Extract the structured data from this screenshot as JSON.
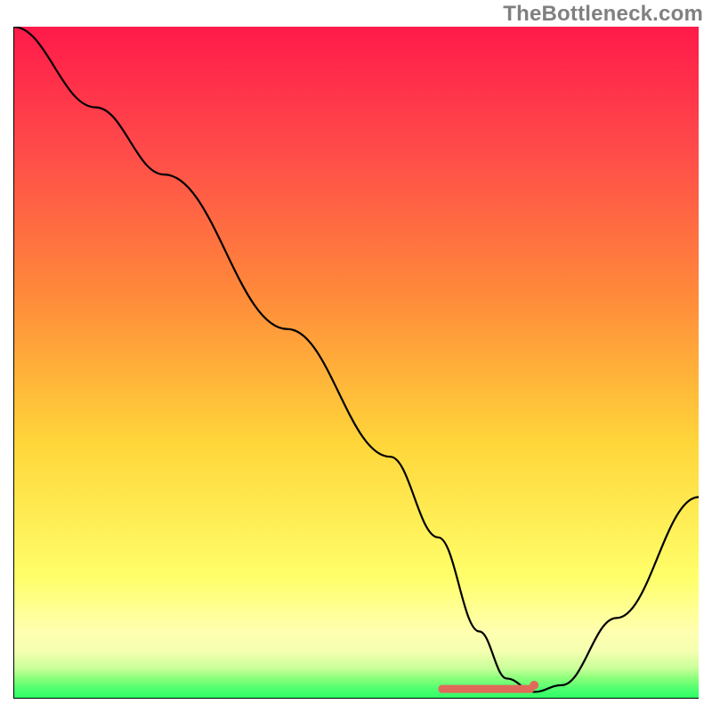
{
  "watermark": "TheBottleneck.com",
  "chart_data": {
    "type": "line",
    "title": "",
    "xlabel": "",
    "ylabel": "",
    "xlim": [
      0,
      100
    ],
    "ylim": [
      0,
      100
    ],
    "background_gradient": {
      "top": "#ff1a4a",
      "mid_top": "#ff8a3a",
      "mid": "#ffd63a",
      "mid_low": "#ffff6a",
      "low": "#ffffb0",
      "bottom": "#2aff66"
    },
    "curve": {
      "x": [
        0,
        12,
        22,
        40,
        55,
        62,
        68,
        72,
        76,
        80,
        88,
        100
      ],
      "y": [
        100,
        88,
        78,
        55,
        36,
        24,
        10,
        3,
        1,
        2,
        12,
        30
      ]
    },
    "flat_segment": {
      "x_start": 62,
      "x_end": 76,
      "y": 1.5
    },
    "marker": {
      "x": 76,
      "y": 2.0,
      "color": "#e06a5a"
    }
  }
}
